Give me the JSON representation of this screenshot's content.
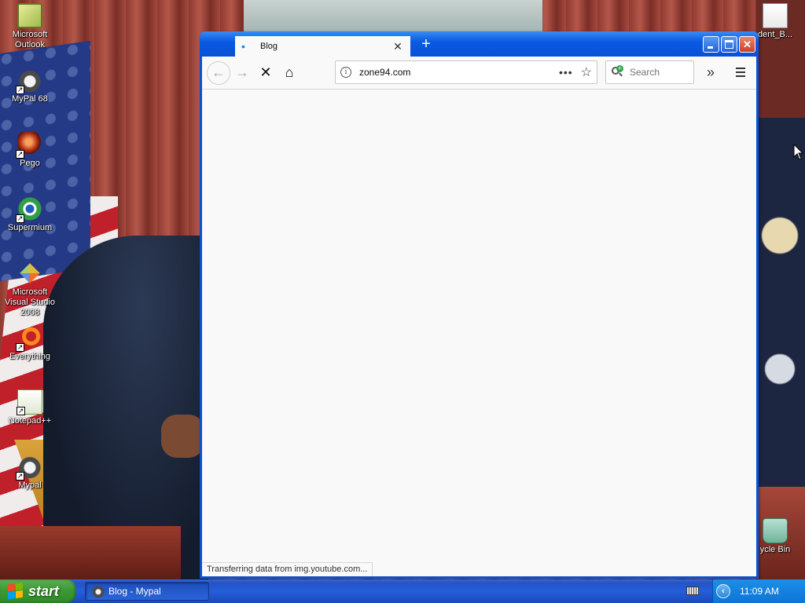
{
  "desktop": {
    "icons": [
      {
        "label": "Microsoft Outlook",
        "icon": "outlook-icon"
      },
      {
        "label": "MyPal 68",
        "icon": "mypal-raccoon-icon"
      },
      {
        "label": "Pego",
        "icon": "pego-icon"
      },
      {
        "label": "Supermium",
        "icon": "supermium-icon"
      },
      {
        "label": "Microsoft Visual Studio 2008",
        "icon": "visual-studio-icon"
      },
      {
        "label": "Everything",
        "icon": "everything-icon"
      },
      {
        "label": "Notepad++",
        "icon": "notepad-plus-plus-icon"
      },
      {
        "label": "Mypal",
        "icon": "mypal-raccoon-icon"
      },
      {
        "label": "dent_B...",
        "icon": "file-icon"
      },
      {
        "label": "ycle Bin",
        "icon": "recycle-bin-icon"
      }
    ]
  },
  "browser": {
    "tab": {
      "title": "Blog",
      "loading": true
    },
    "new_tab_symbol": "+",
    "url": "zone94.com",
    "search_placeholder": "Search",
    "status_text": "Transferring data from img.youtube.com...",
    "glyphs": {
      "back": "←",
      "forward": "→",
      "stop": "✕",
      "home": "⌂",
      "page_actions": "•••",
      "bookmark": "☆",
      "overflow": "»",
      "tab_close": "✕",
      "win_close": "✕",
      "info": "i"
    }
  },
  "taskbar": {
    "start_label": "start",
    "task_title": "Blog - Mypal",
    "clock": "11:09 AM",
    "tray_arrow": "‹"
  }
}
